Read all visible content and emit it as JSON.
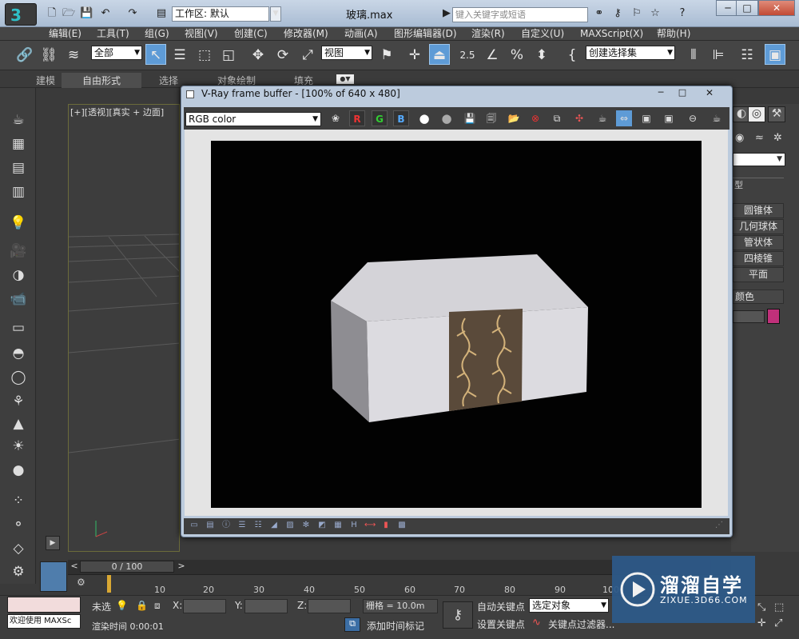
{
  "titlebar": {
    "workspace_label": "工作区: 默认",
    "document_title": "玻璃.max",
    "search_placeholder": "键入关键字或短语",
    "win_minimize": "─",
    "win_restore": "□",
    "win_close": "✕"
  },
  "menubar": [
    "编辑(E)",
    "工具(T)",
    "组(G)",
    "视图(V)",
    "创建(C)",
    "修改器(M)",
    "动画(A)",
    "图形编辑器(D)",
    "渲染(R)",
    "自定义(U)",
    "MAXScript(X)",
    "帮助(H)"
  ],
  "toolbar": {
    "selection_filter": "全部",
    "reference_coord": "视图",
    "named_selection": "创建选择集",
    "snap_angle_label": "2.5"
  },
  "ribbon": {
    "tabs": [
      "建模",
      "自由形式",
      "选择",
      "对象绘制",
      "填充"
    ],
    "active_tab": "自由形式"
  },
  "viewport": {
    "label": "[+][透视][真实 + 边面]"
  },
  "command_panel": {
    "items": [
      "圆锥体",
      "几何球体",
      "管状体",
      "四棱锥",
      "平面"
    ],
    "section_label": "颜色",
    "color_swatch": "#c0307a"
  },
  "vray": {
    "title": "V-Ray frame buffer - [100% of 640 x 480]",
    "channel": "RGB color",
    "channel_r": "R",
    "channel_g": "G",
    "channel_b": "B",
    "win_minimize": "─",
    "win_maximize": "□",
    "win_close": "✕",
    "status_h": "H"
  },
  "timeline": {
    "frame_slider": "0 / 100",
    "ticks": [
      "10",
      "20",
      "30",
      "40",
      "50",
      "60",
      "70",
      "80",
      "90",
      "100"
    ],
    "prev": "<",
    "next": ">"
  },
  "statusbar": {
    "welcome": "欢迎使用 MAXSc",
    "selection_status": "未选",
    "x_label": "X:",
    "y_label": "Y:",
    "z_label": "Z:",
    "grid": "栅格 = 10.0m",
    "render_time": "渲染时间 0:00:01",
    "add_time_tag": "添加时间标记",
    "auto_key": "自动关键点",
    "set_key": "设置关键点",
    "selected_object": "选定对象",
    "key_filter": "关键点过滤器..."
  },
  "watermark": {
    "text": "溜溜自学",
    "sub": "ZIXUE.3D66.COM"
  }
}
